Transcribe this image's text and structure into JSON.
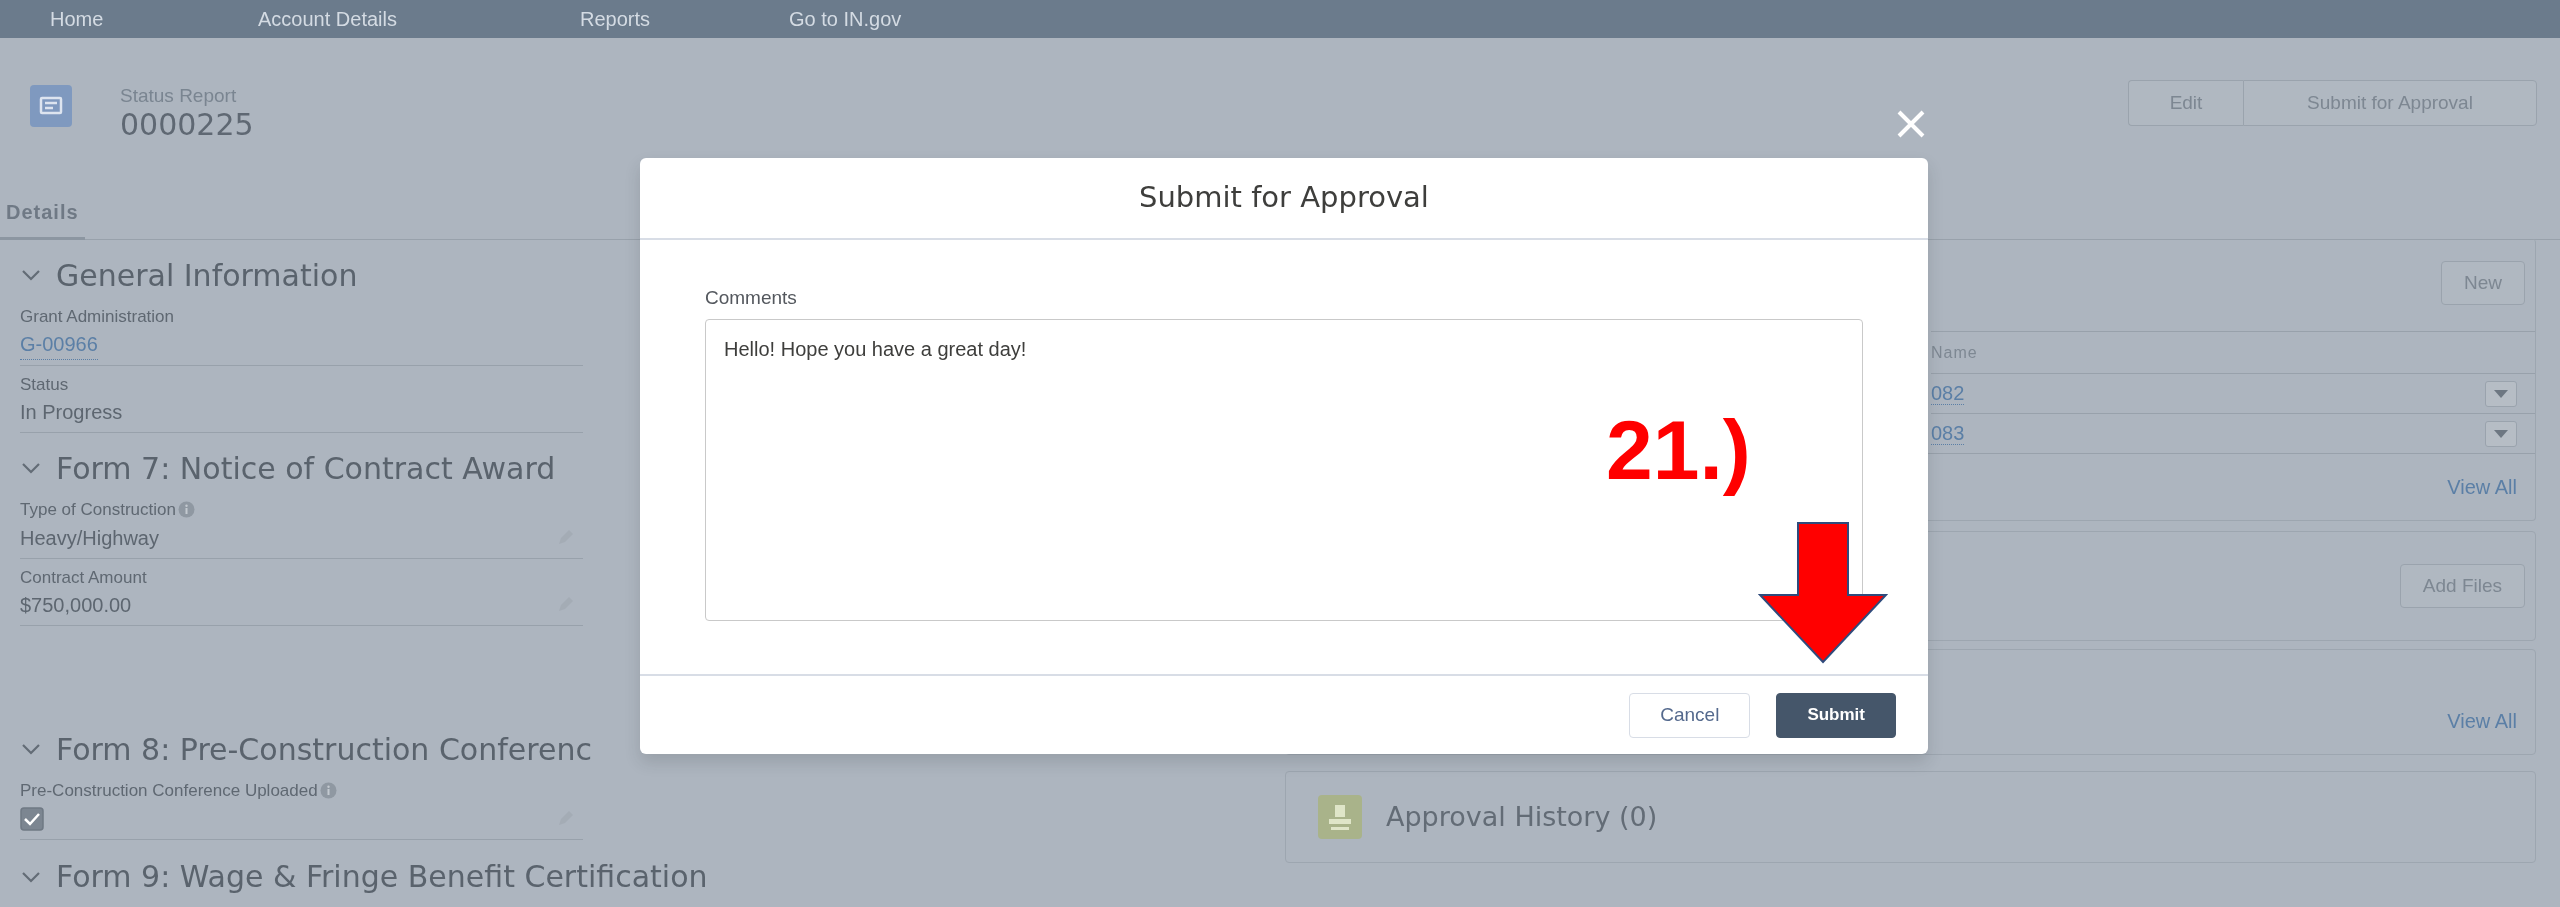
{
  "nav": [
    {
      "label": "Home"
    },
    {
      "label": "Account Details"
    },
    {
      "label": "Reports"
    },
    {
      "label": "Go to IN.gov"
    }
  ],
  "record": {
    "type_label": "Status Report",
    "number": "0000225"
  },
  "header_buttons": [
    "Edit",
    "Submit for Approval"
  ],
  "tabs": [
    {
      "label": "Details",
      "selected": true
    }
  ],
  "sections": [
    {
      "title": "General Information",
      "expanded": true,
      "fields": [
        {
          "label": "Grant Administration",
          "kind": "link",
          "value": "G-00966",
          "info": false,
          "editable": false
        },
        {
          "label": "Status",
          "kind": "text",
          "value": "In Progress",
          "info": false,
          "editable": false
        }
      ]
    },
    {
      "title": "Form 7: Notice of Contract Award",
      "expanded": true,
      "fields": [
        {
          "label": "Type of Construction",
          "kind": "text",
          "value": "Heavy/Highway",
          "info": true,
          "editable": true
        },
        {
          "label": "Contract Amount",
          "kind": "text",
          "value": "$750,000.00",
          "info": false,
          "editable": true
        }
      ]
    },
    {
      "title": "Form 8: Pre-Construction Conferenc",
      "expanded": true,
      "fields": [
        {
          "label": "Pre-Construction Conference Uploaded",
          "kind": "checkbox",
          "checked": true,
          "info": true,
          "editable": true
        }
      ]
    },
    {
      "title": "Form 9: Wage & Fringe Benefit Certification",
      "expanded": true
    }
  ],
  "line_items": {
    "new_button": "New",
    "column": "Name",
    "rows": [
      {
        "name": "082"
      },
      {
        "name": "083"
      }
    ],
    "view_all": "View All"
  },
  "files": {
    "button": "Add Files"
  },
  "third_card": {
    "view_all": "View All"
  },
  "approval_history": {
    "title": "Approval History (0)"
  },
  "modal": {
    "title": "Submit for Approval",
    "comments_label": "Comments",
    "comments_value": "Hello! Hope you have a great day!",
    "buttons": [
      {
        "label": "Cancel",
        "kind": "neutral"
      },
      {
        "label": "Submit",
        "kind": "brand"
      }
    ]
  },
  "annotation": {
    "label": "21.)"
  }
}
